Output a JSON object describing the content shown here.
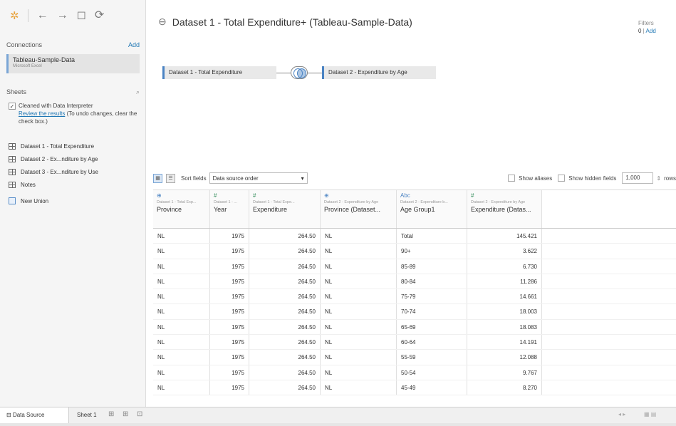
{
  "toolbar": {
    "logo_icon": "tableau-logo-icon",
    "back_icon": "←",
    "forward_icon": "→",
    "save_icon": "◻",
    "refresh_icon": "⟳"
  },
  "connections": {
    "heading": "Connections",
    "add_label": "Add",
    "item_name": "Tableau-Sample-Data",
    "item_type": "Microsoft Excel"
  },
  "sheets": {
    "heading": "Sheets",
    "interpreter_label": "Cleaned with Data Interpreter",
    "review_link": "Review the results",
    "review_note": "(To undo changes, clear the check box.)",
    "items": [
      {
        "label": "Dataset 1 - Total Expenditure"
      },
      {
        "label": "Dataset 2 - Ex...nditure by Age"
      },
      {
        "label": "Dataset 3 - Ex...nditure by Use"
      },
      {
        "label": "Notes"
      }
    ],
    "new_union": "New Union"
  },
  "main": {
    "title": "Dataset 1 - Total Expenditure+ (Tableau-Sample-Data)",
    "filters_label": "Filters",
    "filters_count": "0",
    "filters_add": "Add",
    "left_table": "Dataset 1 - Total Expenditure",
    "right_table": "Dataset 2 - Expenditure by Age"
  },
  "grid_toolbar": {
    "sort_label": "Sort fields",
    "sort_value": "Data source order",
    "show_aliases": "Show aliases",
    "show_hidden": "Show hidden fields",
    "rows_value": "1,000",
    "rows_label": "rows"
  },
  "columns": [
    {
      "type_icon": "⊕",
      "kind": "geo",
      "source": "Dataset 1 - Total Exp...",
      "name": "Province",
      "align": "left"
    },
    {
      "type_icon": "#",
      "kind": "num",
      "source": "Dataset 1 - ...",
      "name": "Year",
      "align": "right"
    },
    {
      "type_icon": "#",
      "kind": "num",
      "source": "Dataset 1 - Total Expe...",
      "name": "Expenditure",
      "align": "right"
    },
    {
      "type_icon": "⊕",
      "kind": "geo",
      "source": "Dataset 2 - Expenditure by Age",
      "name": "Province (Dataset...",
      "align": "left"
    },
    {
      "type_icon": "Abc",
      "kind": "abc",
      "source": "Dataset 2 - Expenditure b...",
      "name": "Age Group1",
      "align": "left"
    },
    {
      "type_icon": "#",
      "kind": "num",
      "source": "Dataset 2 - Expenditure by Age",
      "name": "Expenditure (Datas...",
      "align": "right"
    }
  ],
  "rows": [
    [
      "NL",
      "1975",
      "264.50",
      "NL",
      "Total",
      "145.421"
    ],
    [
      "NL",
      "1975",
      "264.50",
      "NL",
      "90+",
      "3.622"
    ],
    [
      "NL",
      "1975",
      "264.50",
      "NL",
      "85-89",
      "6.730"
    ],
    [
      "NL",
      "1975",
      "264.50",
      "NL",
      "80-84",
      "11.286"
    ],
    [
      "NL",
      "1975",
      "264.50",
      "NL",
      "75-79",
      "14.661"
    ],
    [
      "NL",
      "1975",
      "264.50",
      "NL",
      "70-74",
      "18.003"
    ],
    [
      "NL",
      "1975",
      "264.50",
      "NL",
      "65-69",
      "18.083"
    ],
    [
      "NL",
      "1975",
      "264.50",
      "NL",
      "60-64",
      "14.191"
    ],
    [
      "NL",
      "1975",
      "264.50",
      "NL",
      "55-59",
      "12.088"
    ],
    [
      "NL",
      "1975",
      "264.50",
      "NL",
      "50-54",
      "9.767"
    ],
    [
      "NL",
      "1975",
      "264.50",
      "NL",
      "45-49",
      "8.270"
    ]
  ],
  "bottom": {
    "data_source_tab": "Data Source",
    "sheet_tab": "Sheet 1"
  },
  "colors": {
    "accent": "#4a83c3",
    "link": "#1f77b4",
    "numeric_type": "#2e8b57"
  }
}
